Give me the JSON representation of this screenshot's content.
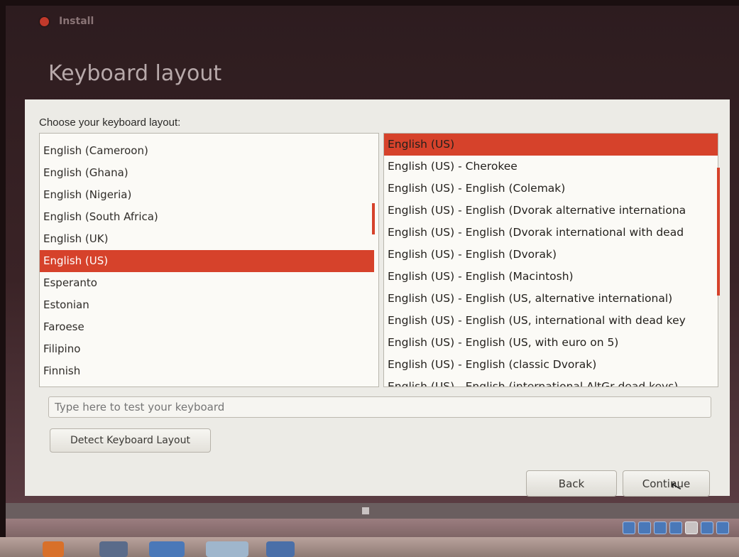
{
  "window": {
    "title": "Install"
  },
  "page": {
    "title": "Keyboard layout"
  },
  "prompt": "Choose your keyboard layout:",
  "layouts_left": {
    "items": [
      "English (Cameroon)",
      "English (Ghana)",
      "English (Nigeria)",
      "English (South Africa)",
      "English (UK)",
      "English (US)",
      "Esperanto",
      "Estonian",
      "Faroese",
      "Filipino",
      "Finnish"
    ],
    "selected": "English (US)"
  },
  "layouts_right": {
    "items": [
      "English (US)",
      "English (US) - Cherokee",
      "English (US) - English (Colemak)",
      "English (US) - English (Dvorak alternative internationa",
      "English (US) - English (Dvorak international with dead",
      "English (US) - English (Dvorak)",
      "English (US) - English (Macintosh)",
      "English (US) - English (US, alternative international)",
      "English (US) - English (US, international with dead key",
      "English (US) - English (US, with euro on 5)",
      "English (US) - English (classic Dvorak)",
      "English (US) - English (international AltGr dead keys)"
    ],
    "selected": "English (US)"
  },
  "test_field": {
    "placeholder": "Type here to test your keyboard",
    "value": ""
  },
  "buttons": {
    "detect": "Detect Keyboard Layout",
    "back": "Back",
    "continue": "Continue"
  },
  "colors": {
    "accent": "#d6422b",
    "panel_bg": "#ecebe6",
    "window_bg": "#2d1c1f"
  },
  "icons": {
    "close": "close-icon",
    "cursor": "mouse-pointer-icon",
    "tray": [
      "network-icon",
      "globe-icon",
      "pen-icon",
      "display-icon",
      "blank-icon",
      "storage-icon",
      "keyboard-icon"
    ]
  }
}
